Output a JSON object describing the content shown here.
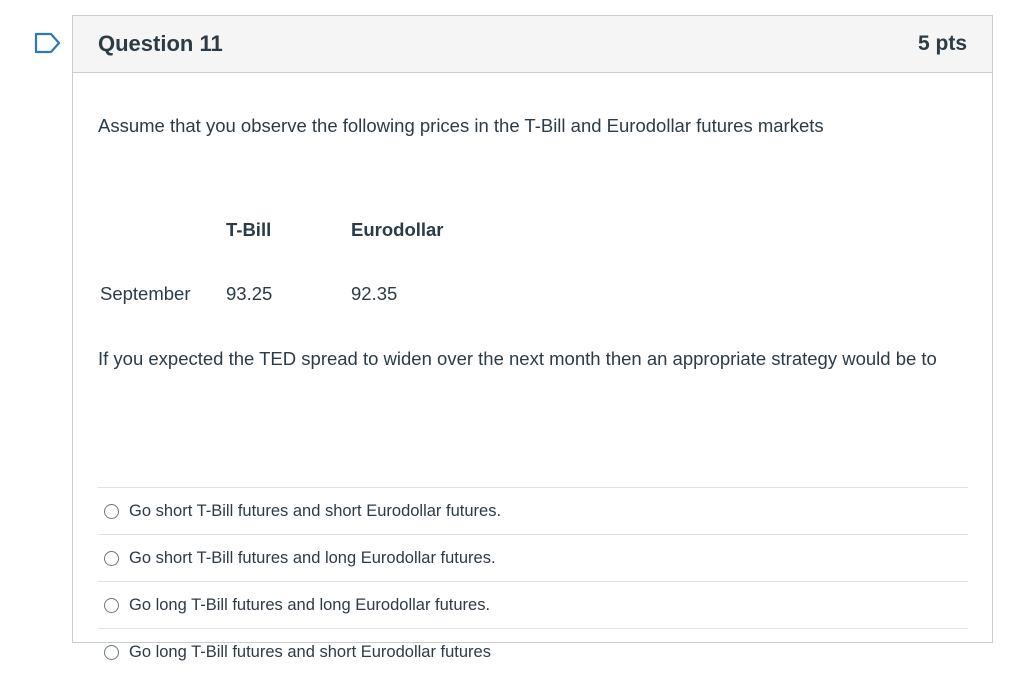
{
  "question": {
    "title": "Question 11",
    "points": "5 pts",
    "prompt": "Assume that you observe the following prices in the T-Bill and Eurodollar futures markets",
    "table": {
      "headers": [
        "T-Bill",
        "Eurodollar"
      ],
      "rows": [
        {
          "label": "September",
          "tbill": "93.25",
          "eurodollar": "92.35"
        }
      ]
    },
    "followup": "If you expected the TED spread to widen over the next month then an appropriate strategy would be to"
  },
  "answers": [
    "Go short T-Bill futures and short Eurodollar futures.",
    "Go short T-Bill futures and long Eurodollar futures.",
    "Go long T-Bill futures and long Eurodollar futures.",
    "Go long T-Bill futures and short Eurodollar futures"
  ],
  "colors": {
    "flag": "#2b7abc",
    "text": "#2d3b45",
    "header_bg": "#f5f5f5",
    "border": "#c7cdd1"
  },
  "icons": {
    "flag": "flag-question-icon",
    "radio": "radio-unchecked-icon"
  }
}
